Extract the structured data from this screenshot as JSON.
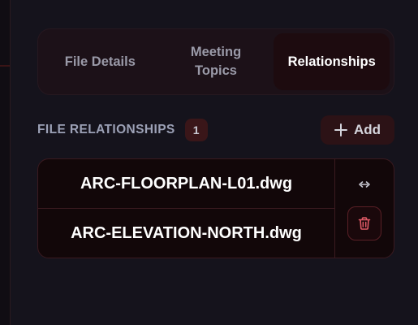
{
  "tabs": [
    {
      "label": "File Details",
      "active": false
    },
    {
      "label": "Meeting\nTopics",
      "active": false
    },
    {
      "label": "Relationships",
      "active": true
    }
  ],
  "relationships": {
    "title": "FILE RELATIONSHIPS",
    "count": "1",
    "add_label": "Add",
    "items": [
      {
        "source": "ARC-FLOORPLAN-L01.dwg",
        "target": "ARC-ELEVATION-NORTH.dwg",
        "link_icon": "bidirectional-arrow-icon",
        "delete_icon": "trash-icon"
      }
    ]
  },
  "colors": {
    "background": "#15131c",
    "accent": "#e05a66",
    "active_tab": "#1d0b0f"
  }
}
